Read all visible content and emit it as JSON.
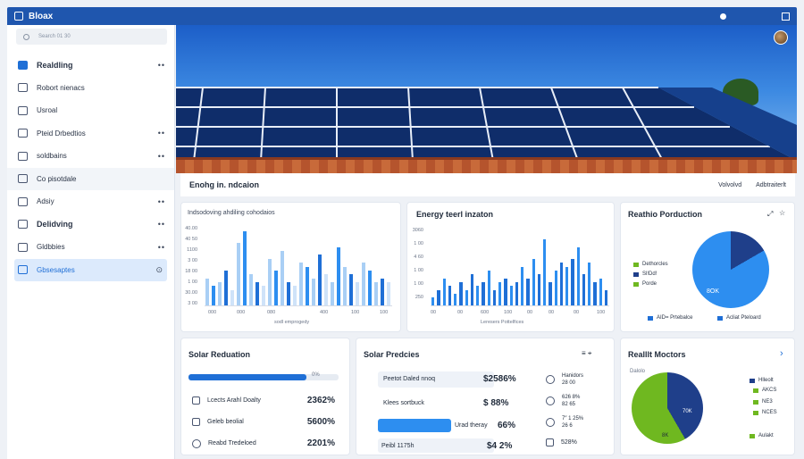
{
  "window": {
    "title": "Bloax"
  },
  "sidebar": {
    "search_placeholder": "Search           01 30",
    "items": [
      {
        "label": "Realdling",
        "icon": "chart-line-icon",
        "bold": true,
        "more": "••"
      },
      {
        "label": "Robort nienacs",
        "icon": "document-icon",
        "more": ""
      },
      {
        "label": "Usroal",
        "icon": "mail-icon",
        "more": ""
      },
      {
        "label": "Pteid Drbedtios",
        "icon": "home-icon",
        "more": "••"
      },
      {
        "label": "soldbains",
        "icon": "grid-icon",
        "more": "••"
      },
      {
        "label": "Co pisotdale",
        "icon": "folder-icon",
        "more": ""
      },
      {
        "label": "Adsiy",
        "icon": "settings-icon",
        "more": "••"
      },
      {
        "label": "Delidving",
        "icon": "chart-icon",
        "bold": true,
        "more": "••"
      },
      {
        "label": "Gldbbies",
        "icon": "globe-icon",
        "more": "••"
      },
      {
        "label": "Gbsesaptes",
        "icon": "bookmark-icon",
        "more": "⊙"
      }
    ]
  },
  "header": {
    "title": "Enohg in. ndcaion",
    "btn1": "Volvolvd",
    "btn2": "Adbtraiterlt"
  },
  "card1": {
    "title": "Indsodoving ahdiling cohodaios",
    "y_ticks": [
      "40.00",
      "40 50",
      "1100",
      "3 00",
      "18 00",
      "1 00",
      "30.00",
      "3 00"
    ],
    "x_ticks": [
      "000",
      "000",
      "080",
      "400",
      "100",
      "100"
    ],
    "caption": "sodl emprogedy"
  },
  "card2": {
    "title": "Energy teerl inzaton",
    "y_ticks": [
      "3060",
      "1 00",
      "4 60",
      "1 00",
      "1 00",
      "250"
    ],
    "x_ticks": [
      "00",
      "00",
      "600",
      "100",
      "00",
      "00",
      "00",
      "100"
    ],
    "caption": "Leresers Pottelfices"
  },
  "card3": {
    "title": "Reathio Porduction",
    "legend": [
      "Dethorcles",
      "Sl!Dd!",
      "Porde"
    ],
    "pie_label": "8OK",
    "footer": [
      "AID= Prtebalce",
      "Acliat Pteloard"
    ]
  },
  "card4": {
    "title": "Solar Reduation",
    "bar_label": "0%",
    "rows": [
      {
        "label": "Lcects Arahl Doalty",
        "value": "2362%"
      },
      {
        "label": "Geleb beolial",
        "value": "5600%"
      },
      {
        "label": "Reabd Tredeloed",
        "value": "2201%"
      }
    ]
  },
  "card5": {
    "title": "Solar Predcies",
    "icons": "≡  ⌖",
    "rows": [
      {
        "label": "Peetot Daled nnoq",
        "value": "$2586%"
      },
      {
        "label": "Klees sortbuck",
        "value": "$ 88%"
      },
      {
        "label": "Urad theray",
        "value": "66%"
      },
      {
        "label": "Peibl 1175h",
        "value": "$4 2%"
      }
    ],
    "side": [
      {
        "label": "Hanidors",
        "value": "28 00"
      },
      {
        "label": "626 8%",
        "value": "82 65"
      },
      {
        "label": "7″ 1 25%",
        "value": "26 6"
      },
      {
        "label": "528%",
        "value": ""
      }
    ]
  },
  "card6": {
    "title": "Realllt Moctors",
    "subtitle": "Dalolo",
    "pie_labels": [
      "70K",
      "8K"
    ],
    "legend": [
      "Hlleolt",
      "AKCS",
      "NE3",
      "NCES",
      "Aulakt"
    ]
  },
  "colors": {
    "accent": "#1f6fd6",
    "dark_blue": "#1f3f8a",
    "green": "#6fb820",
    "light_blue": "#a9cff5"
  }
}
